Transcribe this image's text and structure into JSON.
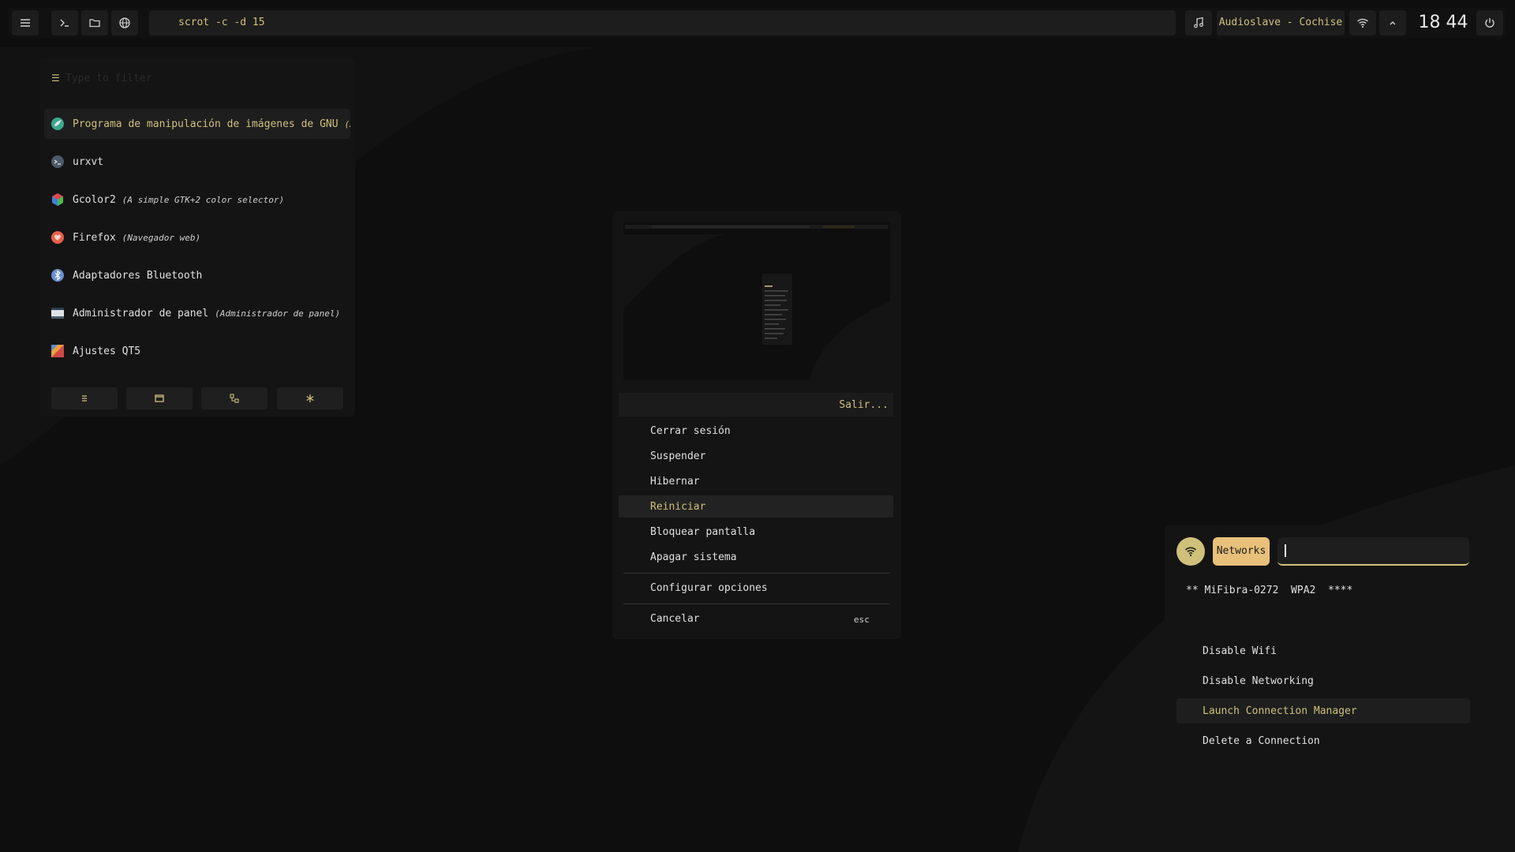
{
  "topbar": {
    "command": "scrot -c -d 15",
    "now_playing": "Audioslave - Cochise",
    "clock": "18 44",
    "icons": [
      "menu-icon",
      "terminal-icon",
      "folder-icon",
      "globe-icon",
      "music-note-icon",
      "wifi-icon",
      "chevron-up-icon",
      "power-icon"
    ]
  },
  "launcher": {
    "filter_placeholder": "Type to filter",
    "items": [
      {
        "name": "Programa de manipulación de imágenes de GNU",
        "desc": "(Edi…",
        "icon": "gimp-icon"
      },
      {
        "name": "urxvt",
        "desc": "",
        "icon": "terminal-icon"
      },
      {
        "name": "Gcolor2",
        "desc": "(A simple GTK+2 color selector)",
        "icon": "gcolor-icon"
      },
      {
        "name": "Firefox",
        "desc": "(Navegador web)",
        "icon": "firefox-icon"
      },
      {
        "name": "Adaptadores Bluetooth",
        "desc": "",
        "icon": "bluetooth-icon"
      },
      {
        "name": "Administrador de panel",
        "desc": "(Administrador de panel)",
        "icon": "panel-icon"
      },
      {
        "name": "Ajustes QT5",
        "desc": "",
        "icon": "qt-settings-icon"
      }
    ],
    "modes": [
      "list-mode-icon",
      "window-mode-icon",
      "tree-mode-icon",
      "asterisk-mode-icon"
    ]
  },
  "power": {
    "title": "Salir...",
    "items": [
      "Cerrar sesión",
      "Suspender",
      "Hibernar",
      "Reiniciar",
      "Bloquear pantalla",
      "Apagar sistema"
    ],
    "configure": "Configurar opciones",
    "cancel": "Cancelar",
    "cancel_key": "esc"
  },
  "network": {
    "label": "Networks",
    "connection": "** MiFibra-0272  WPA2  ****",
    "items": [
      "Disable Wifi",
      "Disable Networking",
      "Launch Connection Manager",
      "Delete a Connection"
    ]
  },
  "colors": {
    "accent": "#cfc07a",
    "badge": "#e8c07a",
    "background": "#0e0e0e",
    "panel": "#141414"
  }
}
